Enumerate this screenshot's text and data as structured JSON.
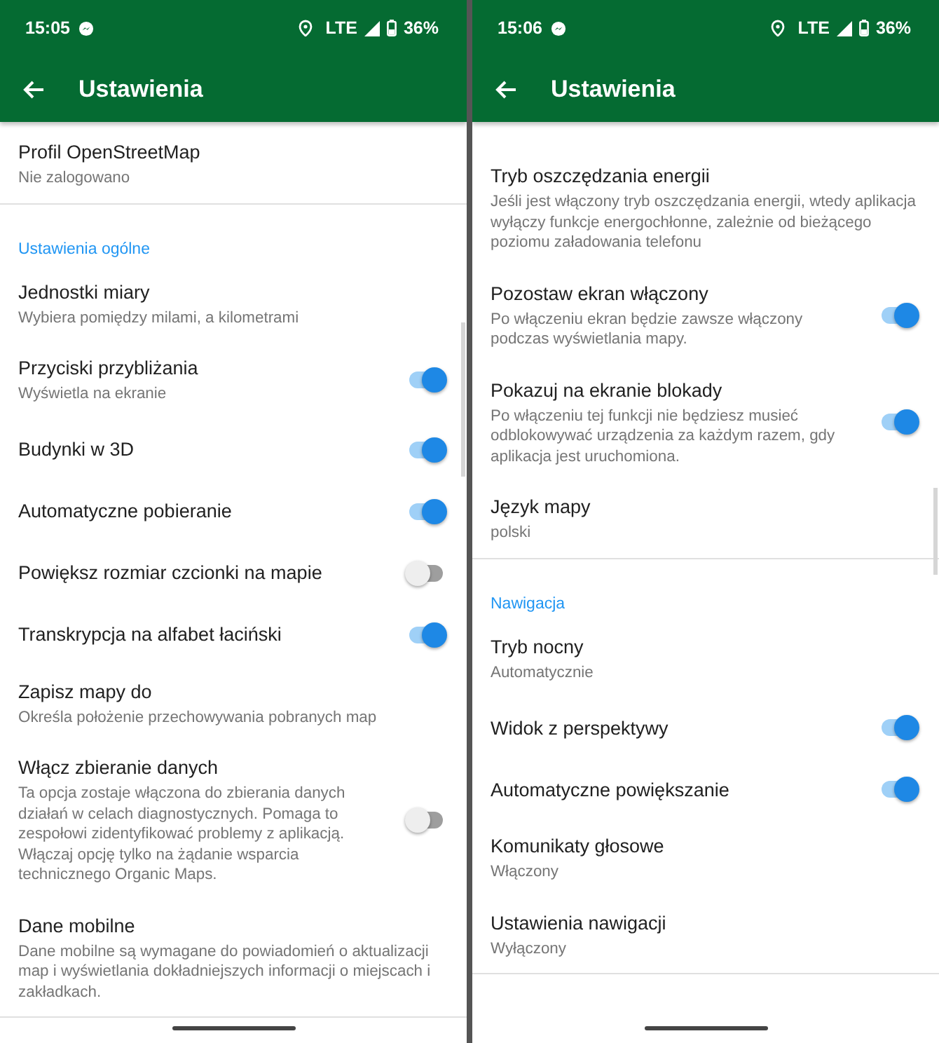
{
  "screens": [
    {
      "status_bar": {
        "time": "15:05",
        "network": "LTE",
        "battery": "36%"
      },
      "toolbar": {
        "title": "Ustawienia"
      },
      "sections": [
        {
          "items": [
            {
              "title": "Profil OpenStreetMap",
              "subtitle": "Nie zalogowano"
            }
          ]
        },
        {
          "header": "Ustawienia ogólne",
          "items": [
            {
              "title": "Jednostki miary",
              "subtitle": "Wybiera pomiędzy milami, a kilometrami"
            },
            {
              "title": "Przyciski przybliżania",
              "subtitle": "Wyświetla na ekranie",
              "kind": "toggle",
              "on": true
            },
            {
              "title": "Budynki w 3D",
              "kind": "toggle",
              "on": true
            },
            {
              "title": "Automatyczne pobieranie",
              "kind": "toggle",
              "on": true
            },
            {
              "title": "Powiększ rozmiar czcionki na mapie",
              "kind": "toggle",
              "on": false
            },
            {
              "title": "Transkrypcja na alfabet łaciński",
              "kind": "toggle",
              "on": true
            },
            {
              "title": "Zapisz mapy do",
              "subtitle": "Określa położenie przechowywania pobranych map"
            },
            {
              "title": "Włącz zbieranie danych",
              "subtitle": "Ta opcja zostaje włączona do zbierania danych działań w celach diagnostycznych. Pomaga to zespołowi zidentyfikować problemy z aplikacją. Włączaj opcję tylko na żądanie wsparcia technicznego Organic Maps.",
              "kind": "toggle",
              "on": false
            },
            {
              "title": "Dane mobilne",
              "subtitle": "Dane mobilne są wymagane do powiadomień o aktualizacji map i wyświetlania dokładniejszych informacji o miejscach i zakładkach."
            }
          ]
        }
      ]
    },
    {
      "status_bar": {
        "time": "15:06",
        "network": "LTE",
        "battery": "36%"
      },
      "toolbar": {
        "title": "Ustawienia"
      },
      "sections": [
        {
          "items": [
            {
              "title": "Tryb oszczędzania energii",
              "subtitle": "Jeśli jest włączony tryb oszczędzania energii, wtedy aplikacja wyłączy funkcje energochłonne, zależnie od bieżącego poziomu załadowania telefonu"
            },
            {
              "title": "Pozostaw ekran włączony",
              "subtitle": "Po włączeniu ekran będzie zawsze włączony podczas wyświetlania mapy.",
              "kind": "toggle",
              "on": true
            },
            {
              "title": "Pokazuj na ekranie blokady",
              "subtitle": "Po włączeniu tej funkcji nie będziesz musieć odblokowywać urządzenia za każdym razem, gdy aplikacja jest uruchomiona.",
              "kind": "toggle",
              "on": true
            },
            {
              "title": "Język mapy",
              "subtitle": "polski"
            }
          ]
        },
        {
          "header": "Nawigacja",
          "items": [
            {
              "title": "Tryb nocny",
              "subtitle": "Automatycznie"
            },
            {
              "title": "Widok z perspektywy",
              "kind": "toggle",
              "on": true
            },
            {
              "title": "Automatyczne powiększanie",
              "kind": "toggle",
              "on": true
            },
            {
              "title": "Komunikaty głosowe",
              "subtitle": "Włączony"
            },
            {
              "title": "Ustawienia nawigacji",
              "subtitle": "Wyłączony"
            }
          ]
        }
      ]
    }
  ]
}
